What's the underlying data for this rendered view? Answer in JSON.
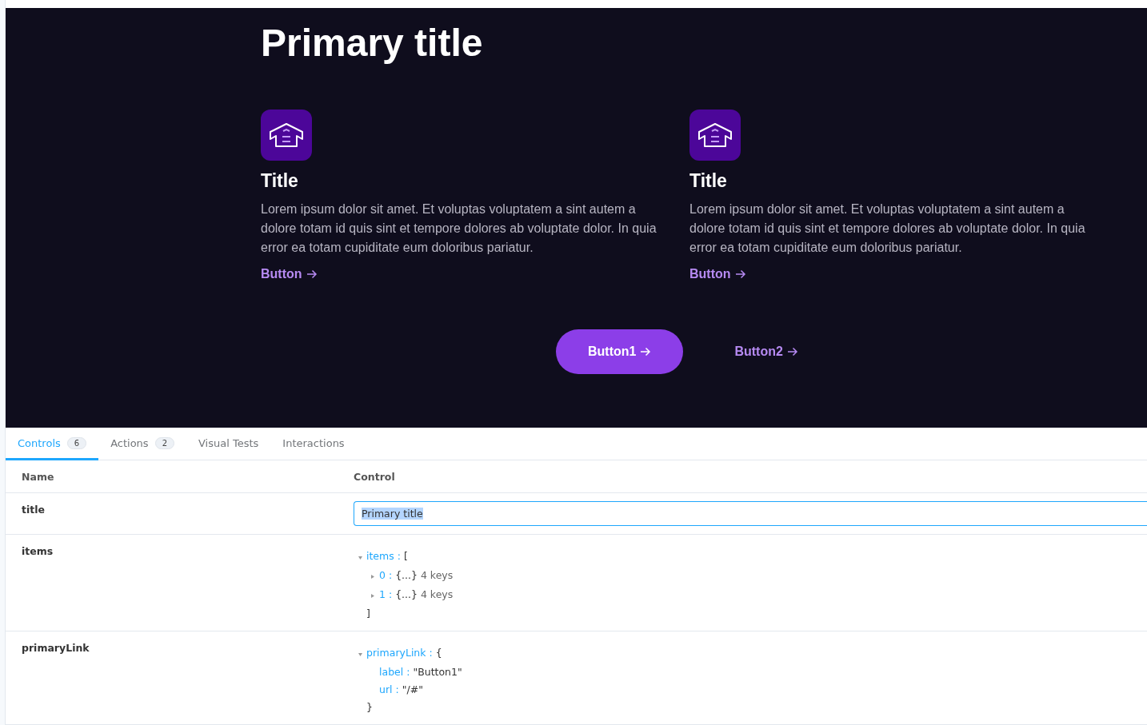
{
  "preview": {
    "title": "Primary title",
    "cards": [
      {
        "title": "Title",
        "text": "Lorem ipsum dolor sit amet. Et voluptas voluptatem a sint autem a dolore totam id quis sint et tempore dolores ab voluptate dolor. In quia error ea totam cupiditate eum doloribus pariatur.",
        "link": "Button"
      },
      {
        "title": "Title",
        "text": "Lorem ipsum dolor sit amet. Et voluptas voluptatem a sint autem a dolore totam id quis sint et tempore dolores ab voluptate dolor. In quia error ea totam cupiditate eum doloribus pariatur.",
        "link": "Button"
      }
    ],
    "buttons": [
      {
        "kind": "primary",
        "label": "Button1"
      },
      {
        "kind": "secondary",
        "label": "Button2"
      }
    ]
  },
  "addons": {
    "tabs": [
      {
        "label": "Controls",
        "count": "6",
        "selected": true
      },
      {
        "label": "Actions",
        "count": "2",
        "selected": false
      },
      {
        "label": "Visual Tests",
        "selected": false
      },
      {
        "label": "Interactions",
        "selected": false
      }
    ],
    "columns": [
      "Name",
      "Control"
    ],
    "rows": [
      {
        "name": "title",
        "kind": "text",
        "value": "Primary title"
      },
      {
        "name": "items",
        "kind": "tree",
        "tree": {
          "key": "items :",
          "open": "[",
          "expanded": true,
          "close": "]",
          "children": [
            {
              "key": "0 :",
              "value": "{...}",
              "note": "4 keys",
              "expanded": false
            },
            {
              "key": "1 :",
              "value": "{...}",
              "note": "4 keys",
              "expanded": false
            }
          ]
        }
      },
      {
        "name": "primaryLink",
        "kind": "tree",
        "tree": {
          "key": "primaryLink :",
          "open": "{",
          "expanded": true,
          "close": "}",
          "children": [
            {
              "key": "label :",
              "value": "\"Button1\""
            },
            {
              "key": "url :",
              "value": "\"/#\""
            }
          ]
        }
      }
    ]
  }
}
